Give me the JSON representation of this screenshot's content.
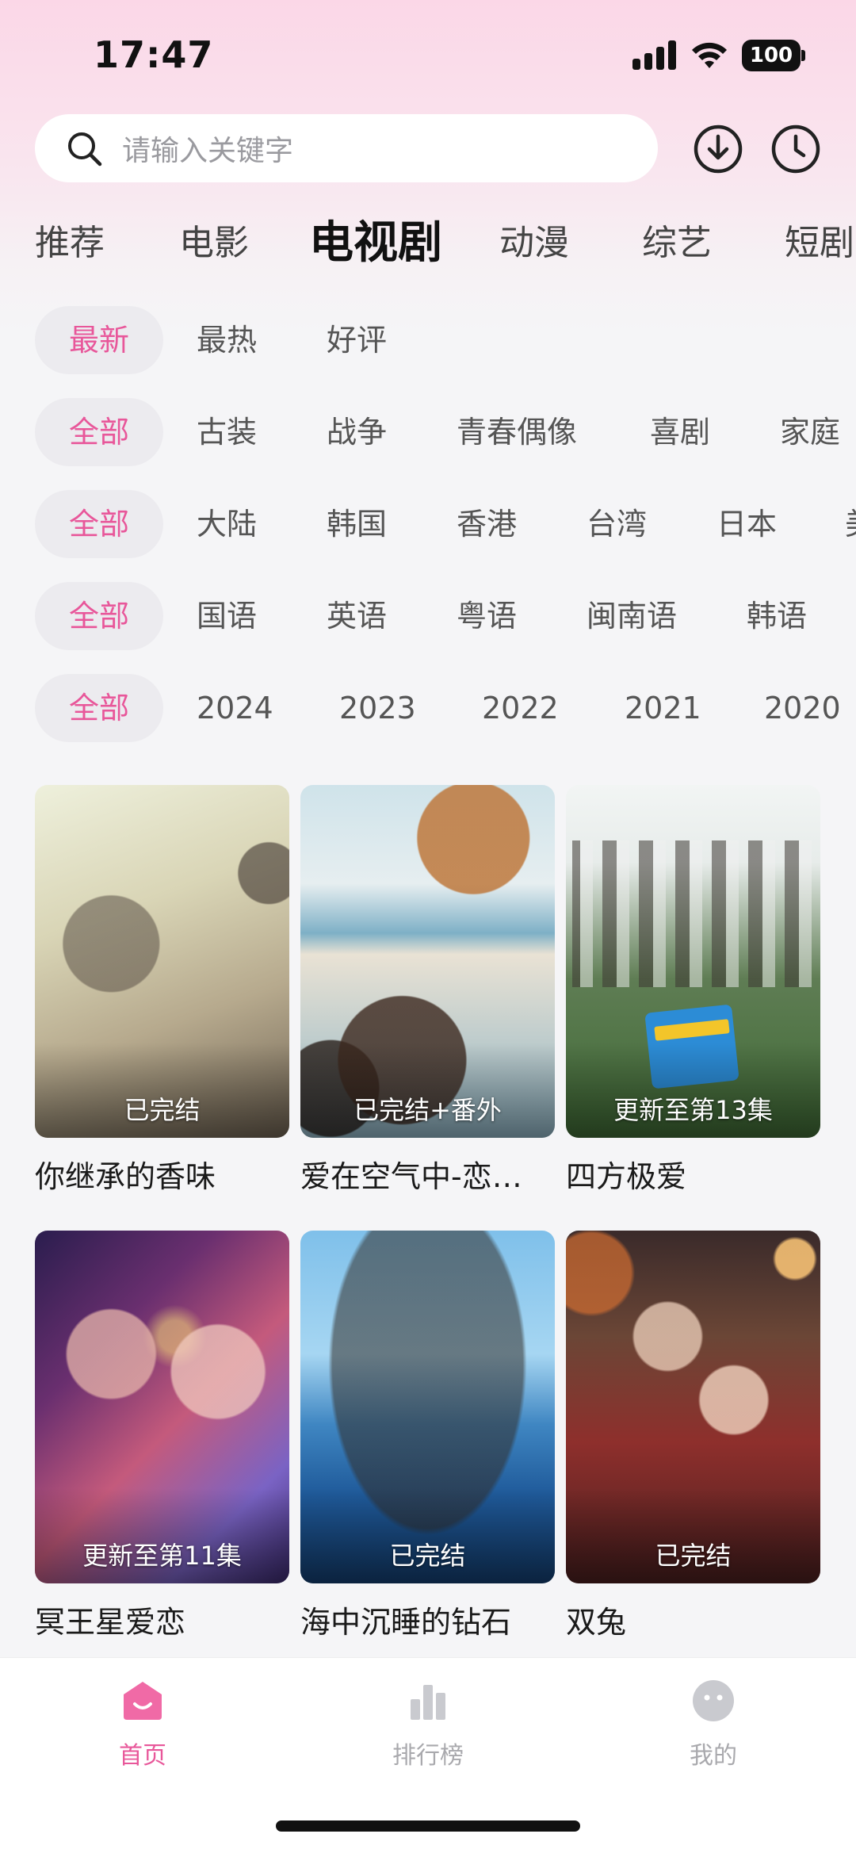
{
  "status": {
    "time": "17:47",
    "battery": "100",
    "icons": [
      "signal-icon",
      "wifi-icon",
      "battery-icon"
    ]
  },
  "search": {
    "placeholder": "请输入关键字",
    "icons": [
      "search-icon",
      "download-icon",
      "history-clock-icon"
    ]
  },
  "categories": {
    "items": [
      "推荐",
      "电影",
      "电视剧",
      "动漫",
      "综艺",
      "短剧"
    ],
    "active": "电视剧"
  },
  "filters": {
    "sort": [
      "最新",
      "最热",
      "好评"
    ],
    "genre": [
      "全部",
      "古装",
      "战争",
      "青春偶像",
      "喜剧",
      "家庭"
    ],
    "region": [
      "全部",
      "大陆",
      "韩国",
      "香港",
      "台湾",
      "日本",
      "美"
    ],
    "language": [
      "全部",
      "国语",
      "英语",
      "粤语",
      "闽南语",
      "韩语"
    ],
    "year": [
      "全部",
      "2024",
      "2023",
      "2022",
      "2021",
      "2020"
    ]
  },
  "dramas": [
    {
      "title": "你继承的香味",
      "status": "已完结"
    },
    {
      "title": "爱在空气中-恋…",
      "status": "已完结+番外"
    },
    {
      "title": "四方极爱",
      "status": "更新至第13集"
    },
    {
      "title": "冥王星爱恋",
      "status": "更新至第11集"
    },
    {
      "title": "海中沉睡的钻石",
      "status": "已完结"
    },
    {
      "title": "双兔",
      "status": "已完结"
    }
  ],
  "nav": {
    "items": [
      {
        "label": "首页",
        "icon": "home-icon"
      },
      {
        "label": "排行榜",
        "icon": "ranking-icon"
      },
      {
        "label": "我的",
        "icon": "profile-icon"
      }
    ],
    "active": "首页"
  },
  "colors": {
    "accent": "#e8579a",
    "header_gradient_top": "#fbd7e7",
    "background": "#f5f5f7"
  }
}
